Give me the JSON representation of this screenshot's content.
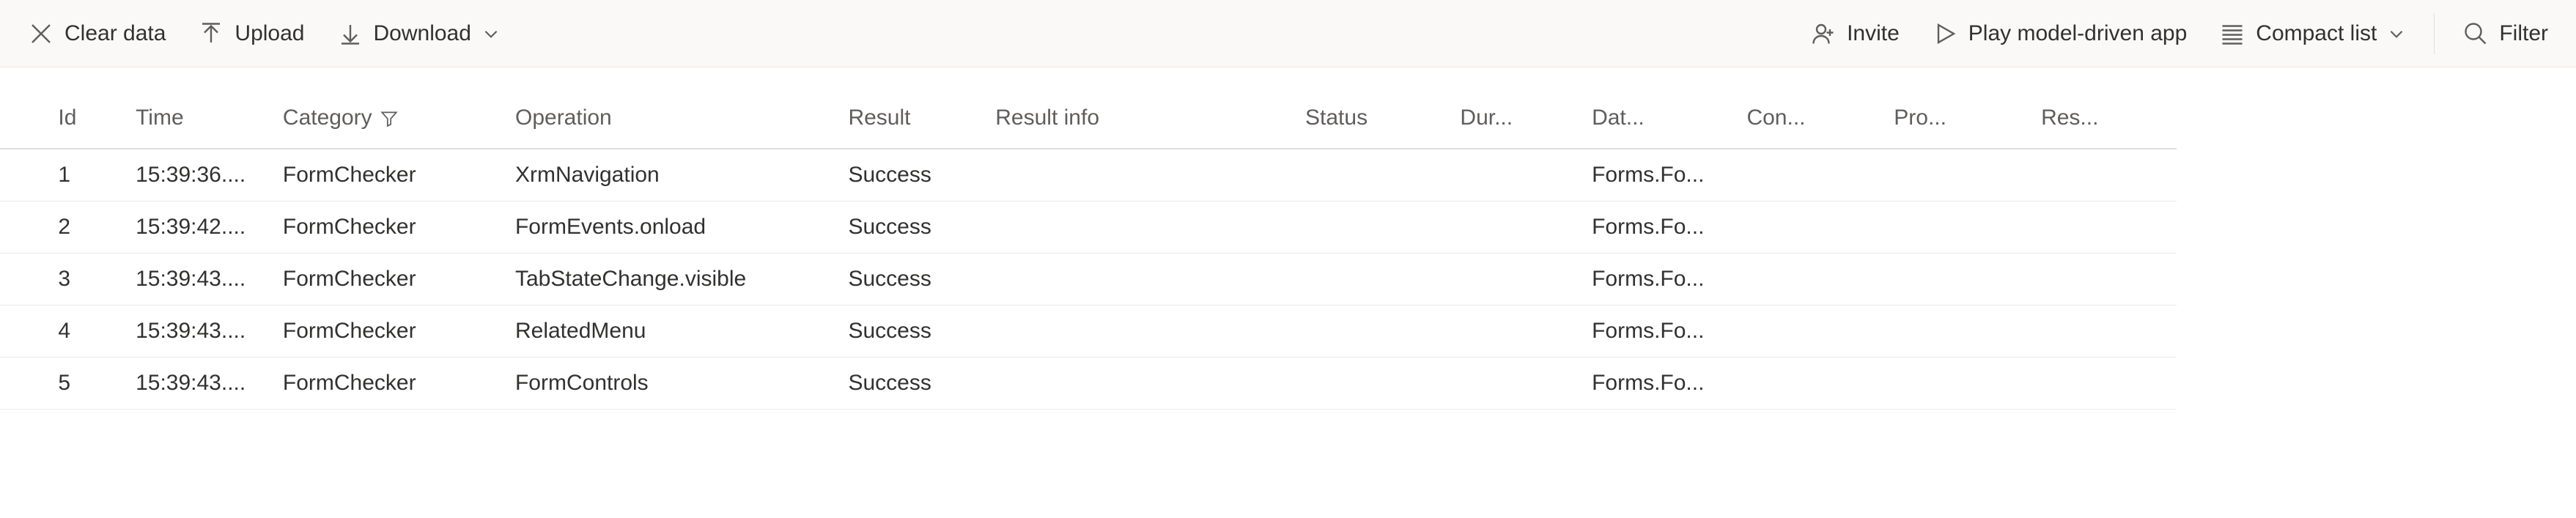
{
  "toolbar": {
    "clear_data_label": "Clear data",
    "upload_label": "Upload",
    "download_label": "Download",
    "invite_label": "Invite",
    "play_label": "Play model-driven app",
    "compact_list_label": "Compact list",
    "filter_label": "Filter"
  },
  "table": {
    "columns": {
      "id": "Id",
      "time": "Time",
      "category": "Category",
      "operation": "Operation",
      "result": "Result",
      "result_info": "Result info",
      "status": "Status",
      "dur": "Dur...",
      "dat": "Dat...",
      "con": "Con...",
      "pro": "Pro...",
      "res": "Res..."
    },
    "rows": [
      {
        "id": "1",
        "time": "15:39:36....",
        "category": "FormChecker",
        "operation": "XrmNavigation",
        "result": "Success",
        "result_info": "",
        "status": "",
        "dur": "",
        "dat": "Forms.Fo...",
        "con": "",
        "pro": "",
        "res": ""
      },
      {
        "id": "2",
        "time": "15:39:42....",
        "category": "FormChecker",
        "operation": "FormEvents.onload",
        "result": "Success",
        "result_info": "",
        "status": "",
        "dur": "",
        "dat": "Forms.Fo...",
        "con": "",
        "pro": "",
        "res": ""
      },
      {
        "id": "3",
        "time": "15:39:43....",
        "category": "FormChecker",
        "operation": "TabStateChange.visible",
        "result": "Success",
        "result_info": "",
        "status": "",
        "dur": "",
        "dat": "Forms.Fo...",
        "con": "",
        "pro": "",
        "res": ""
      },
      {
        "id": "4",
        "time": "15:39:43....",
        "category": "FormChecker",
        "operation": "RelatedMenu",
        "result": "Success",
        "result_info": "",
        "status": "",
        "dur": "",
        "dat": "Forms.Fo...",
        "con": "",
        "pro": "",
        "res": ""
      },
      {
        "id": "5",
        "time": "15:39:43....",
        "category": "FormChecker",
        "operation": "FormControls",
        "result": "Success",
        "result_info": "",
        "status": "",
        "dur": "",
        "dat": "Forms.Fo...",
        "con": "",
        "pro": "",
        "res": ""
      }
    ]
  }
}
